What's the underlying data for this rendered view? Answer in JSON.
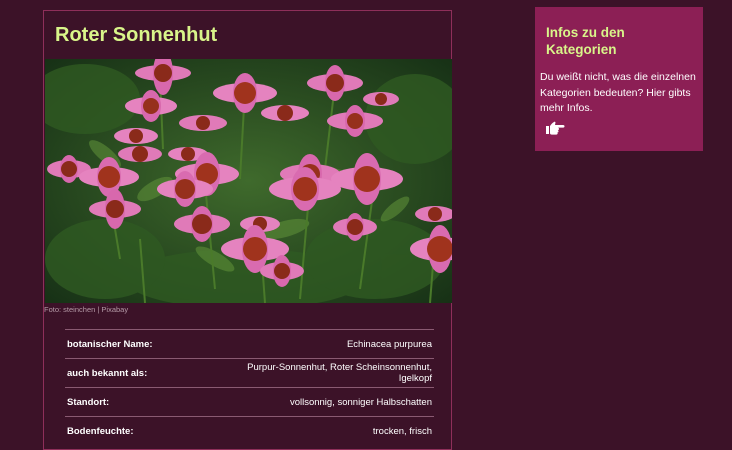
{
  "plant": {
    "title": "Roter Sonnenhut",
    "photo_alt": "Foto eines Beets mit Rotem Sonnenhut",
    "photo_credit": "Foto: steinchen | Pixabay",
    "rows": [
      {
        "label": "botanischer Name:",
        "value": "Echinacea purpurea"
      },
      {
        "label": "auch bekannt als:",
        "value": "Purpur-Sonnenhut, Roter Scheinsonnenhut, Igelkopf"
      },
      {
        "label": "Standort:",
        "value": "vollsonnig, sonniger Halbschatten"
      },
      {
        "label": "Bodenfeuchte:",
        "value": "trocken, frisch"
      }
    ]
  },
  "sidebar": {
    "heading": "Infos zu den Kategorien",
    "text": "Du weißt nicht, was die einzelnen Kategorien bedeuten? Hier gibts mehr Infos.",
    "link_icon": "hand-pointing-right-icon"
  },
  "colors": {
    "background": "#3c1228",
    "accent": "#d9f58a",
    "sidebar_bg": "#8c1f55"
  }
}
